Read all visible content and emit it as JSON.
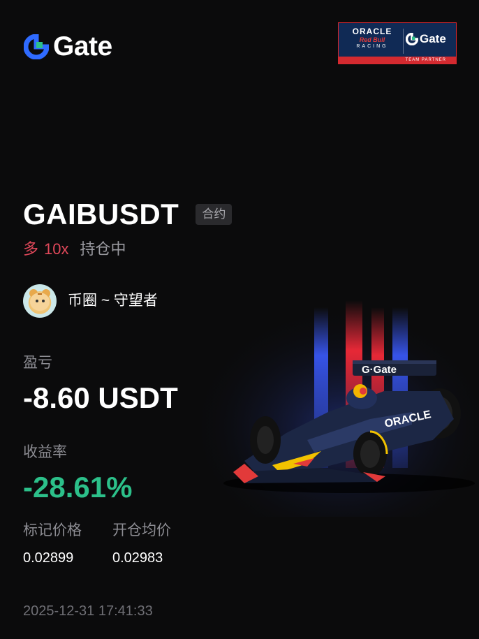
{
  "header": {
    "brand_name": "Gate",
    "brand_icon": "gate-logo-icon",
    "brand_color": "#2f6bff",
    "partner": {
      "oracle": "ORACLE",
      "redbull": "Red Bull",
      "racing": "RACING",
      "gate": "Gate",
      "strip": "TEAM PARTNER"
    }
  },
  "position": {
    "symbol": "GAIBUSDT",
    "type_tag": "合约",
    "side": "多",
    "leverage": "10x",
    "status": "持仓中"
  },
  "user": {
    "name": "币圈 ~ 守望者",
    "avatar_icon": "tiger-avatar"
  },
  "pnl": {
    "label": "盈亏",
    "value": "-8.60 USDT"
  },
  "rate": {
    "label": "收益率",
    "value": "-28.61%",
    "color": "#2cc08a"
  },
  "prices": {
    "mark_label": "标记价格",
    "mark_value": "0.02899",
    "entry_label": "开仓均价",
    "entry_value": "0.02983"
  },
  "timestamp": "2025-12-31 17:41:33",
  "colors": {
    "long": "#e0485a",
    "profit_negative": "#2cc08a",
    "background": "#0b0b0c"
  }
}
